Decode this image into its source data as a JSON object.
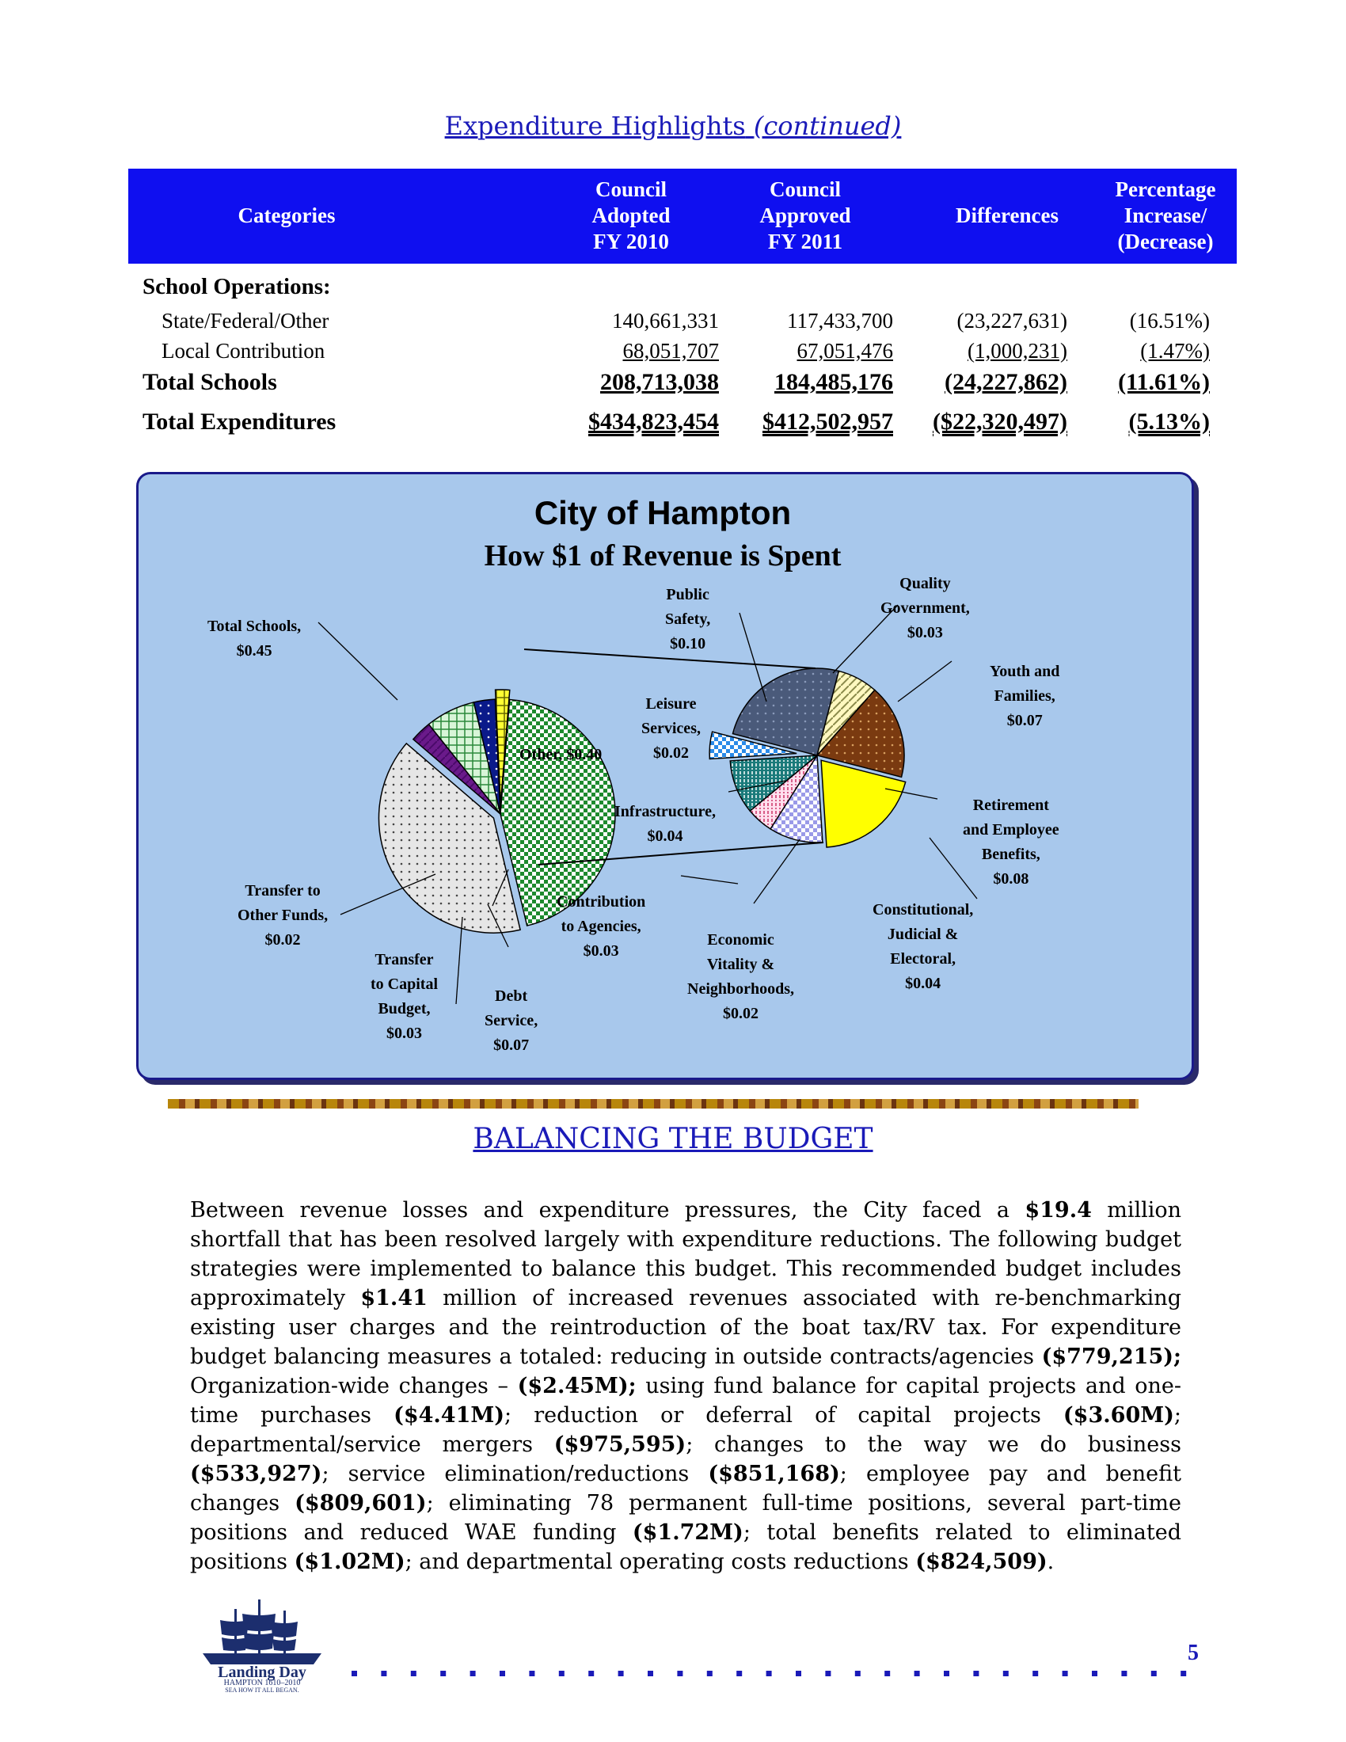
{
  "page": {
    "title_main": "Expenditure Highlights",
    "title_cont": "(continued)",
    "page_number": "5"
  },
  "table": {
    "headers": {
      "categories": "Categories",
      "fy2010": [
        "Council",
        "Adopted",
        "FY 2010"
      ],
      "fy2011": [
        "Council",
        "Approved",
        "FY 2011"
      ],
      "differences": "Differences",
      "pct": [
        "Percentage",
        "Increase/",
        "(Decrease)"
      ]
    },
    "section_label": "School Operations:",
    "rows": [
      {
        "label": "State/Federal/Other",
        "fy2010": "140,661,331",
        "fy2011": "117,433,700",
        "diff": "(23,227,631)",
        "pct": "(16.51%)"
      },
      {
        "label": "Local Contribution",
        "fy2010": "68,051,707",
        "fy2011": "67,051,476",
        "diff": "(1,000,231)",
        "pct": "(1.47%)"
      }
    ],
    "total_schools": {
      "label": "Total Schools",
      "fy2010": "208,713,038",
      "fy2011": "184,485,176",
      "diff": "(24,227,862)",
      "pct": "(11.61%)"
    },
    "total_expenditures": {
      "label": "Total Expenditures",
      "fy2010": "$434,823,454",
      "fy2011": "$412,502,957",
      "diff": "($22,320,497)",
      "pct": "(5.13%)"
    }
  },
  "chart_data": {
    "type": "pie",
    "title": "City of Hampton",
    "subtitle": "How $1 of Revenue is Spent",
    "main_pie": [
      {
        "label": "Total Schools",
        "value": 0.45
      },
      {
        "label": "Other",
        "value": 0.4
      },
      {
        "label": "Contribution to Agencies",
        "value": 0.03
      },
      {
        "label": "Debt Service",
        "value": 0.07
      },
      {
        "label": "Transfer to Capital Budget",
        "value": 0.03
      },
      {
        "label": "Transfer to Other Funds",
        "value": 0.02
      }
    ],
    "other_breakdown": [
      {
        "label": "Public Safety",
        "value": 0.1
      },
      {
        "label": "Quality Government",
        "value": 0.03
      },
      {
        "label": "Youth and Families",
        "value": 0.07
      },
      {
        "label": "Retirement and Employee Benefits",
        "value": 0.08
      },
      {
        "label": "Constitutional, Judicial & Electoral",
        "value": 0.04
      },
      {
        "label": "Economic Vitality & Neighborhoods",
        "value": 0.02
      },
      {
        "label": "Infrastructure",
        "value": 0.04
      },
      {
        "label": "Leisure Services",
        "value": 0.02
      }
    ],
    "labels": {
      "total_schools": [
        "Total Schools,",
        "$0.45"
      ],
      "other": "Other, $0.40",
      "contribution": [
        "Contribution",
        "to Agencies,",
        "$0.03"
      ],
      "debt": [
        "Debt",
        "Service,",
        "$0.07"
      ],
      "transfer_capital": [
        "Transfer",
        "to Capital",
        "Budget,",
        "$0.03"
      ],
      "transfer_other": [
        "Transfer to",
        "Other Funds,",
        "$0.02"
      ],
      "public_safety": [
        "Public",
        "Safety,",
        "$0.10"
      ],
      "quality_government": [
        "Quality",
        "Government,",
        "$0.03"
      ],
      "youth": [
        "Youth and",
        "Families,",
        "$0.07"
      ],
      "retirement": [
        "Retirement",
        "and Employee",
        "Benefits,",
        "$0.08"
      ],
      "constitutional": [
        "Constitutional,",
        "Judicial &",
        "Electoral,",
        "$0.04"
      ],
      "economic": [
        "Economic",
        "Vitality &",
        "Neighborhoods,",
        "$0.02"
      ],
      "infrastructure": [
        "Infrastructure,",
        "$0.04"
      ],
      "leisure": [
        "Leisure",
        "Services,",
        "$0.02"
      ]
    }
  },
  "balancing": {
    "title": "BALANCING THE BUDGET",
    "t1": "Between revenue losses and expenditure pressures, the City faced a ",
    "v1": "$19.4",
    "t2": " million shortfall that has been resolved largely with expenditure reductions. The following budget strategies were implemented to balance this budget. This recommended budget includes approximately ",
    "v2": "$1.41",
    "t3": " million of increased revenues associated with re-benchmarking existing user charges and the reintroduction of the boat tax/RV tax.  For expenditure budget balancing measures a totaled: reducing in outside contracts/agencies ",
    "v3": "($779,215);",
    "t4": " Organization-wide changes – ",
    "v4": "($2.45M);",
    "t5": " using fund balance for capital projects and one-time purchases ",
    "v5": "($4.41M)",
    "t6": "; reduction or deferral of capital projects ",
    "v6": "($3.60M)",
    "t7": "; departmental/service mergers ",
    "v7": "($975,595)",
    "t8": "; changes to the way we do business ",
    "v8": "($533,927)",
    "t9": "; service elimination/reductions ",
    "v9": "($851,168)",
    "t10": "; employee pay and benefit changes ",
    "v10": "($809,601)",
    "t11": "; eliminating 78 permanent full-time positions, several part-time positions and reduced WAE funding ",
    "v11": "($1.72M)",
    "t12": "; total benefits related to eliminated positions ",
    "v12": "($1.02M)",
    "t13": "; and departmental operating costs reductions ",
    "v13": "($824,509)",
    "t14": "."
  },
  "logo": {
    "line1": "Landing Day",
    "line2": "HAMPTON 1610–2010",
    "line3": "SEA HOW IT ALL BEGAN."
  },
  "colors": {
    "header_bg": "#0f0ff0",
    "title_blue": "#1a1ab8",
    "chart_bg": "#a8c8ec"
  }
}
